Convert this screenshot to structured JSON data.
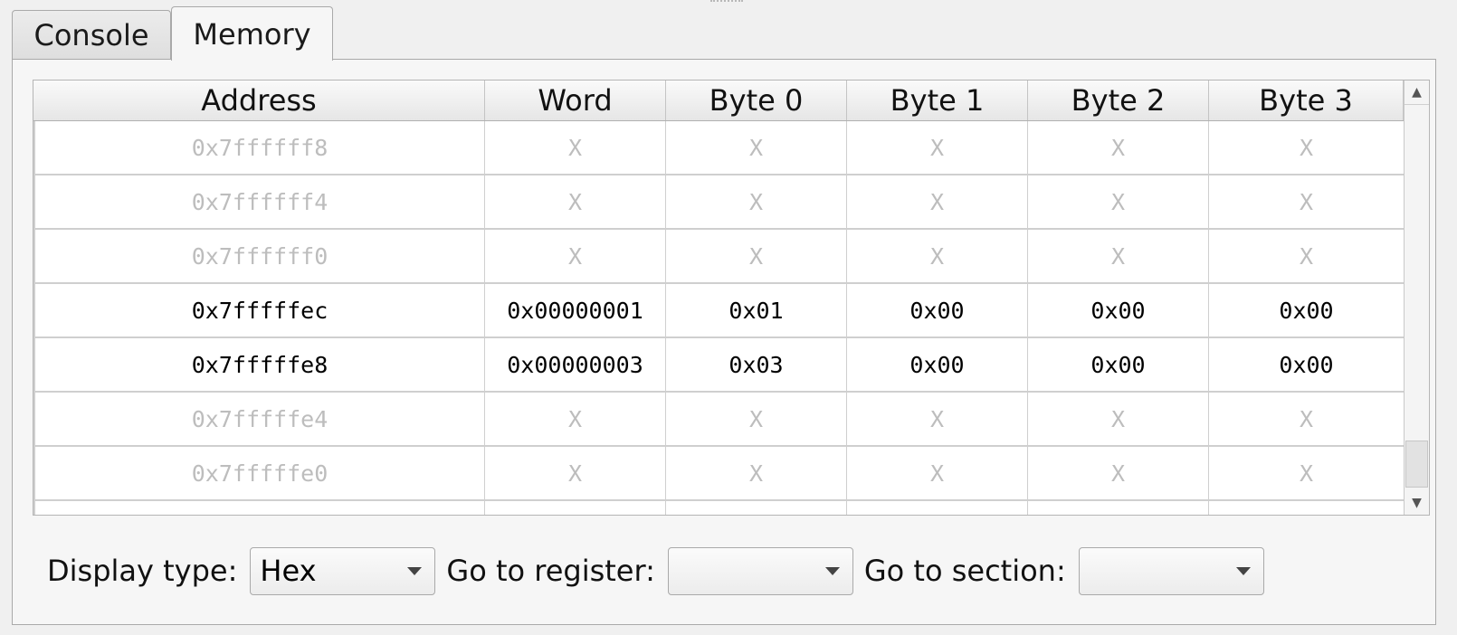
{
  "tabs": [
    {
      "label": "Console",
      "active": false
    },
    {
      "label": "Memory",
      "active": true
    }
  ],
  "table": {
    "columns": [
      "Address",
      "Word",
      "Byte 0",
      "Byte 1",
      "Byte 2",
      "Byte 3"
    ],
    "rows": [
      {
        "address": "0x7ffffff8",
        "word": "X",
        "b0": "X",
        "b1": "X",
        "b2": "X",
        "b3": "X",
        "inactive": true
      },
      {
        "address": "0x7ffffff4",
        "word": "X",
        "b0": "X",
        "b1": "X",
        "b2": "X",
        "b3": "X",
        "inactive": true
      },
      {
        "address": "0x7ffffff0",
        "word": "X",
        "b0": "X",
        "b1": "X",
        "b2": "X",
        "b3": "X",
        "inactive": true
      },
      {
        "address": "0x7fffffec",
        "word": "0x00000001",
        "b0": "0x01",
        "b1": "0x00",
        "b2": "0x00",
        "b3": "0x00",
        "inactive": false
      },
      {
        "address": "0x7fffffe8",
        "word": "0x00000003",
        "b0": "0x03",
        "b1": "0x00",
        "b2": "0x00",
        "b3": "0x00",
        "inactive": false
      },
      {
        "address": "0x7fffffe4",
        "word": "X",
        "b0": "X",
        "b1": "X",
        "b2": "X",
        "b3": "X",
        "inactive": true
      },
      {
        "address": "0x7fffffe0",
        "word": "X",
        "b0": "X",
        "b1": "X",
        "b2": "X",
        "b3": "X",
        "inactive": true
      },
      {
        "address": "",
        "word": "",
        "b0": "",
        "b1": "",
        "b2": "",
        "b3": "",
        "inactive": true
      }
    ]
  },
  "controls": {
    "display_type_label": "Display type:",
    "display_type_value": "Hex",
    "go_to_register_label": "Go to register:",
    "go_to_register_value": "",
    "go_to_section_label": "Go to section:",
    "go_to_section_value": ""
  },
  "icons": {
    "scroll_up": "triangle-up-icon",
    "scroll_down": "triangle-down-icon",
    "dropdown": "triangle-down-icon"
  }
}
